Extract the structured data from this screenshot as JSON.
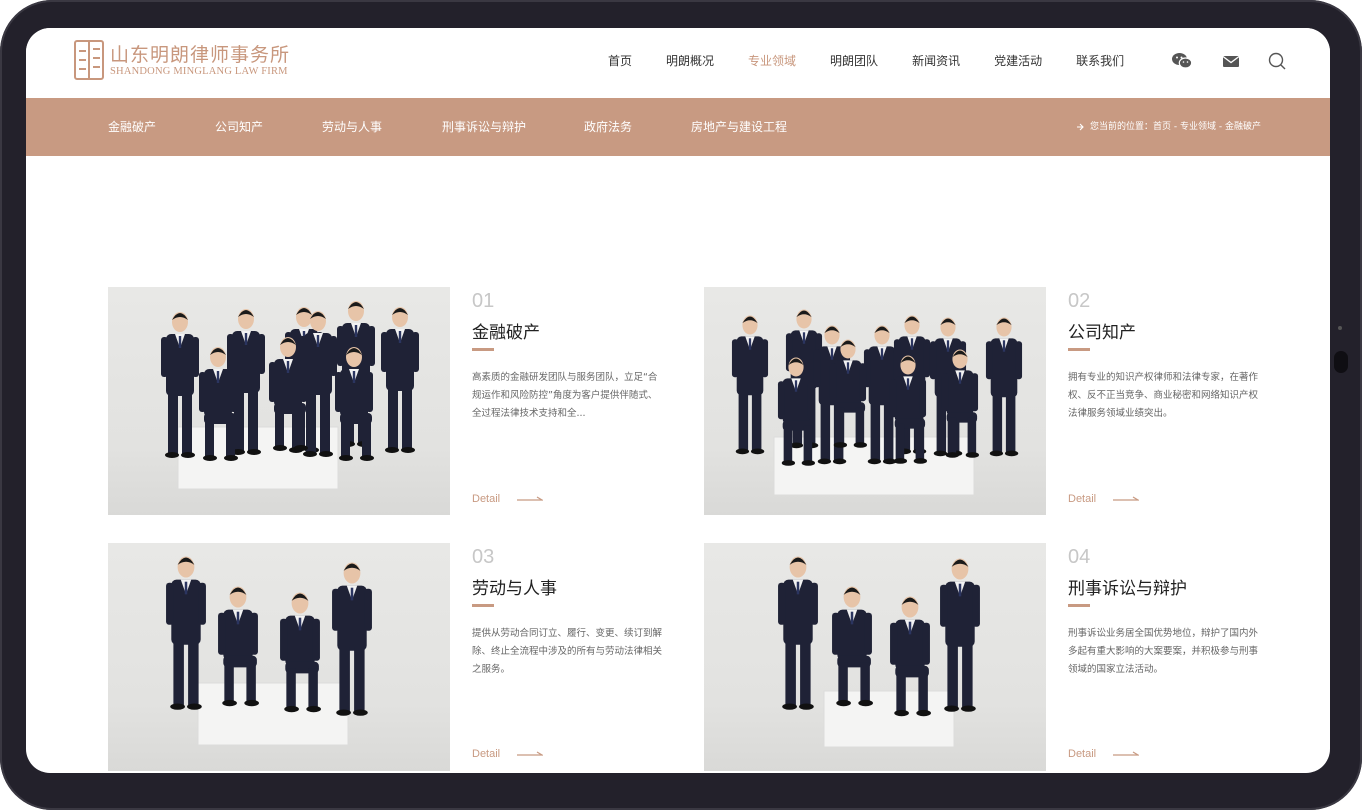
{
  "brand": {
    "name_cn": "山东明朗律师事务所",
    "name_en": "SHANDONG MINGLANG LAW FIRM",
    "accent_color": "#c89a82"
  },
  "nav": {
    "items": [
      {
        "label": "首页",
        "active": false
      },
      {
        "label": "明朗概况",
        "active": false
      },
      {
        "label": "专业领域",
        "active": true
      },
      {
        "label": "明朗团队",
        "active": false
      },
      {
        "label": "新闻资讯",
        "active": false
      },
      {
        "label": "党建活动",
        "active": false
      },
      {
        "label": "联系我们",
        "active": false
      }
    ],
    "icons": [
      "wechat-icon",
      "mail-icon",
      "search-icon"
    ]
  },
  "subnav": {
    "items": [
      "金融破产",
      "公司知产",
      "劳动与人事",
      "刑事诉讼与辩护",
      "政府法务",
      "房地产与建设工程"
    ],
    "breadcrumb": "您当前的位置：首页 - 专业领域 - 金融破产"
  },
  "cards": [
    {
      "num": "01",
      "title": "金融破产",
      "desc": "高素质的金融研发团队与服务团队，立足“合规运作和风险防控”角度为客户提供伴随式、全过程法律技术支持和全...",
      "detail": "Detail"
    },
    {
      "num": "02",
      "title": "公司知产",
      "desc": "拥有专业的知识产权律师和法律专家，在著作权、反不正当竞争、商业秘密和网络知识产权法律服务领域业绩突出。",
      "detail": "Detail"
    },
    {
      "num": "03",
      "title": "劳动与人事",
      "desc": "提供从劳动合同订立、履行、变更、续订到解除、终止全流程中涉及的所有与劳动法律相关之服务。",
      "detail": "Detail"
    },
    {
      "num": "04",
      "title": "刑事诉讼与辩护",
      "desc": "刑事诉讼业务居全国优势地位，辩护了国内外多起有重大影响的大案要案，并积极参与刑事领域的国家立法活动。",
      "detail": "Detail"
    }
  ]
}
